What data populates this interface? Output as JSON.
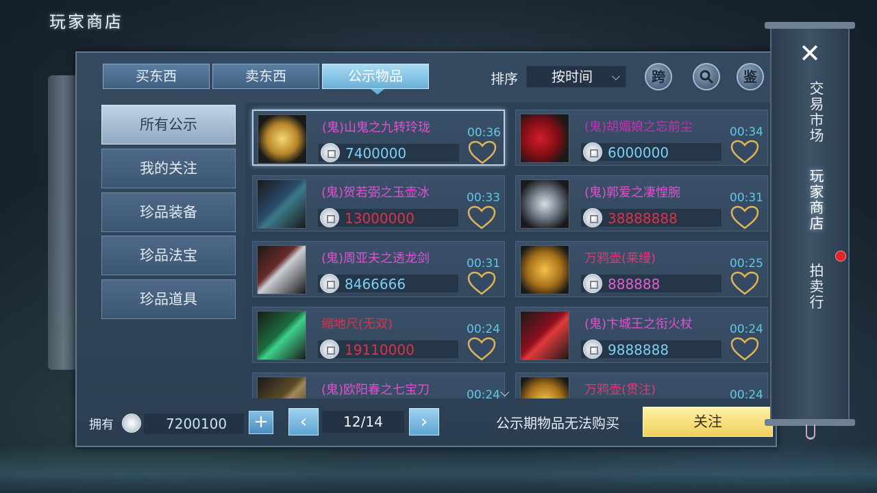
{
  "header": {
    "title": "玩家商店"
  },
  "tabs": [
    {
      "label": "买东西",
      "active": false
    },
    {
      "label": "卖东西",
      "active": false
    },
    {
      "label": "公示物品",
      "active": true
    }
  ],
  "sort": {
    "label": "排序",
    "value": "按时间"
  },
  "top_buttons": [
    {
      "label": "跨"
    },
    {
      "label": "search-icon"
    },
    {
      "label": "鉴"
    }
  ],
  "sidebar": {
    "items": [
      {
        "label": "所有公示",
        "active": true
      },
      {
        "label": "我的关注",
        "active": false
      },
      {
        "label": "珍品装备",
        "active": false
      },
      {
        "label": "珍品法宝",
        "active": false
      },
      {
        "label": "珍品道具",
        "active": false
      }
    ]
  },
  "items": [
    {
      "name": "(鬼)山鬼之九转玲珑",
      "price": "7400000",
      "time": "00:36",
      "name_color": "#e24fd2",
      "price_color": "#7fd0f0",
      "icon": "golden-orb-icon",
      "selected": true
    },
    {
      "name": "(鬼)胡媚娘之忘前尘",
      "price": "6000000",
      "time": "00:34",
      "name_color": "#c42fb8",
      "price_color": "#7fd0f0",
      "icon": "red-fan-icon",
      "selected": false
    },
    {
      "name": "(鬼)贺若弼之玉壶冰",
      "price": "13000000",
      "time": "00:33",
      "name_color": "#e24fd2",
      "price_color": "#e0304a",
      "icon": "jade-whip-icon",
      "selected": false
    },
    {
      "name": "(鬼)郭爱之凄惶腕",
      "price": "38888888",
      "time": "00:31",
      "name_color": "#e24fd2",
      "price_color": "#e0304a",
      "icon": "bracer-icon",
      "selected": false
    },
    {
      "name": "(鬼)周亚夫之透龙剑",
      "price": "8466666",
      "time": "00:31",
      "name_color": "#e24fd2",
      "price_color": "#7fd0f0",
      "icon": "sword-icon",
      "selected": false
    },
    {
      "name": "万鸦壶(莱缦)",
      "price": "888888",
      "time": "00:25",
      "name_color": "#d83a7a",
      "price_color": "#e55fd0",
      "icon": "golden-pot-icon",
      "selected": false
    },
    {
      "name": "缩地尺(无双)",
      "price": "19110000",
      "time": "00:24",
      "name_color": "#e0304a",
      "price_color": "#e0304a",
      "icon": "jade-ruler-icon",
      "selected": false
    },
    {
      "name": "(鬼)卞城王之衔火杖",
      "price": "9888888",
      "time": "00:24",
      "name_color": "#e24fd2",
      "price_color": "#7fd0f0",
      "icon": "fire-staff-icon",
      "selected": false
    },
    {
      "name": "(鬼)欧阳春之七宝刀",
      "price": "",
      "time": "00:24",
      "name_color": "#e24fd2",
      "price_color": "#7fd0f0",
      "icon": "blade-icon",
      "selected": false
    },
    {
      "name": "万鸦壶(贯注)",
      "price": "",
      "time": "00:24",
      "name_color": "#d83a7a",
      "price_color": "#7fd0f0",
      "icon": "golden-pot-icon",
      "selected": false
    }
  ],
  "footer": {
    "own_label": "拥有",
    "own_value": "7200100",
    "plus_label": "+",
    "page": "12/14",
    "prev_label": "‹",
    "next_label": "›",
    "notice": "公示期物品无法购买",
    "follow_label": "关注"
  },
  "right_menu": {
    "close_label": "✕",
    "items": [
      {
        "label": "交易市场",
        "active": false
      },
      {
        "label": "玩家商店",
        "active": true
      },
      {
        "label": "拍卖行",
        "active": false
      }
    ]
  },
  "colors": {
    "accent": "#6bb0d8",
    "time": "#62c6e8",
    "follow": "#f1cf5a",
    "heart": "#e0b45a"
  }
}
